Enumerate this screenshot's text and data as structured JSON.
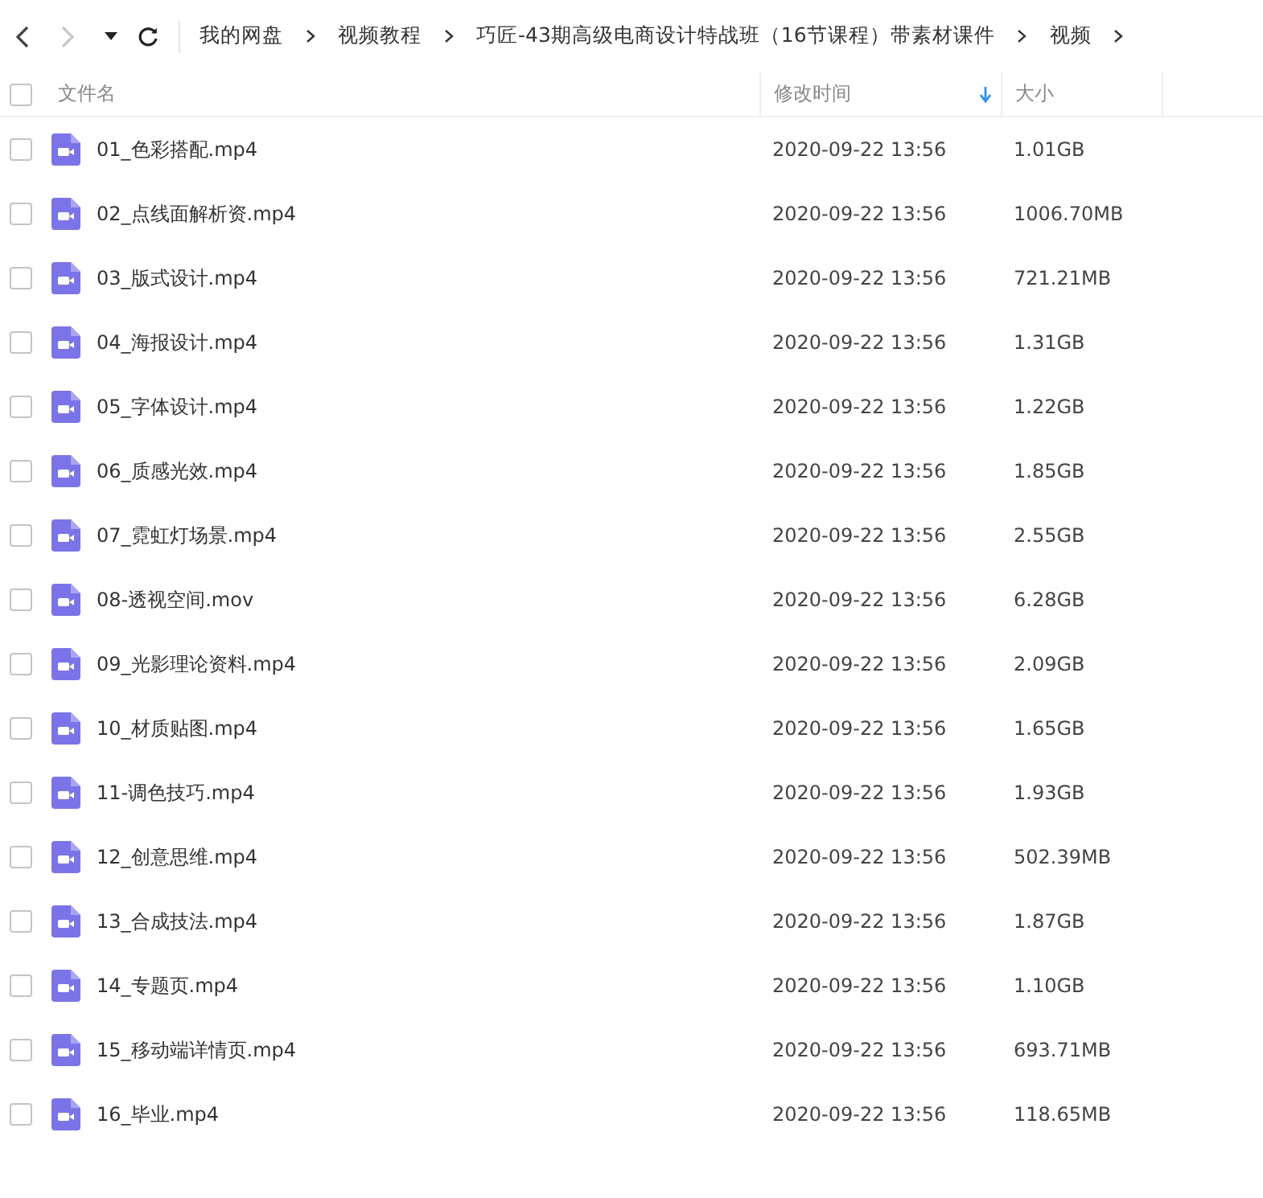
{
  "nav": [
    {
      "kind": "back",
      "disabled": false
    },
    {
      "kind": "forward",
      "disabled": true
    },
    {
      "kind": "dropdown",
      "disabled": false
    },
    {
      "kind": "refresh",
      "disabled": false
    }
  ],
  "breadcrumb": [
    "我的网盘",
    "视频教程",
    "巧匠-43期高级电商设计特战班（16节课程）带素材课件",
    "视频"
  ],
  "header": {
    "checked": false,
    "columns": [
      {
        "label": "文件名",
        "sorted": false
      },
      {
        "label": "修改时间",
        "sorted": true
      },
      {
        "label": "大小",
        "sorted": false
      }
    ]
  },
  "rows": [
    {
      "name": "01_色彩搭配.mp4",
      "modified": "2020-09-22 13:56",
      "size": "1.01GB",
      "checked": false
    },
    {
      "name": "02_点线面解析资.mp4",
      "modified": "2020-09-22 13:56",
      "size": "1006.70MB",
      "checked": false
    },
    {
      "name": "03_版式设计.mp4",
      "modified": "2020-09-22 13:56",
      "size": "721.21MB",
      "checked": false
    },
    {
      "name": "04_海报设计.mp4",
      "modified": "2020-09-22 13:56",
      "size": "1.31GB",
      "checked": false
    },
    {
      "name": "05_字体设计.mp4",
      "modified": "2020-09-22 13:56",
      "size": "1.22GB",
      "checked": false
    },
    {
      "name": "06_质感光效.mp4",
      "modified": "2020-09-22 13:56",
      "size": "1.85GB",
      "checked": false
    },
    {
      "name": "07_霓虹灯场景.mp4",
      "modified": "2020-09-22 13:56",
      "size": "2.55GB",
      "checked": false
    },
    {
      "name": "08-透视空间.mov",
      "modified": "2020-09-22 13:56",
      "size": "6.28GB",
      "checked": false
    },
    {
      "name": "09_光影理论资料.mp4",
      "modified": "2020-09-22 13:56",
      "size": "2.09GB",
      "checked": false
    },
    {
      "name": "10_材质贴图.mp4",
      "modified": "2020-09-22 13:56",
      "size": "1.65GB",
      "checked": false
    },
    {
      "name": "11-调色技巧.mp4",
      "modified": "2020-09-22 13:56",
      "size": "1.93GB",
      "checked": false
    },
    {
      "name": "12_创意思维.mp4",
      "modified": "2020-09-22 13:56",
      "size": "502.39MB",
      "checked": false
    },
    {
      "name": "13_合成技法.mp4",
      "modified": "2020-09-22 13:56",
      "size": "1.87GB",
      "checked": false
    },
    {
      "name": "14_专题页.mp4",
      "modified": "2020-09-22 13:56",
      "size": "1.10GB",
      "checked": false
    },
    {
      "name": "15_移动端详情页.mp4",
      "modified": "2020-09-22 13:56",
      "size": "693.71MB",
      "checked": false
    },
    {
      "name": "16_毕业.mp4",
      "modified": "2020-09-22 13:56",
      "size": "118.65MB",
      "checked": false
    }
  ]
}
